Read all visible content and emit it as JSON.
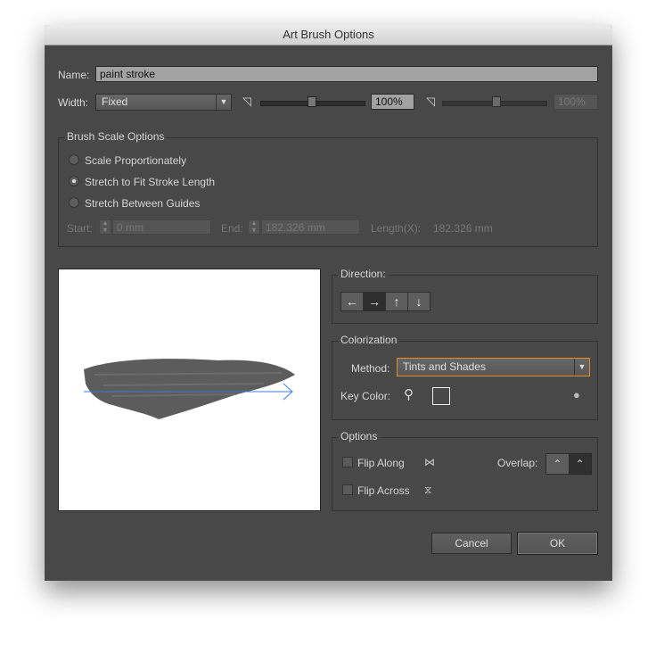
{
  "title": "Art Brush Options",
  "name": {
    "label": "Name:",
    "value": "paint stroke"
  },
  "width": {
    "label": "Width:",
    "selected": "Fixed",
    "value1": "100%",
    "value2": "100%",
    "slider1_percent": 100,
    "slider2_percent": 100
  },
  "brush_scale": {
    "title": "Brush Scale Options",
    "options": [
      "Scale Proportionately",
      "Stretch to Fit Stroke Length",
      "Stretch Between Guides"
    ],
    "selected_index": 1,
    "start_label": "Start:",
    "start_value": "0 mm",
    "end_label": "End:",
    "end_value": "182.326 mm",
    "length_label": "Length(X):",
    "length_value": "182.326 mm"
  },
  "direction": {
    "title": "Direction:",
    "buttons": [
      "←",
      "→",
      "↑",
      "↓"
    ],
    "selected_index": 1
  },
  "colorization": {
    "title": "Colorization",
    "method_label": "Method:",
    "method_value": "Tints and Shades",
    "key_color_label": "Key Color:",
    "accent": "#e8892b"
  },
  "options": {
    "title": "Options",
    "flip_along": "Flip Along",
    "flip_across": "Flip Across",
    "overlap_label": "Overlap:"
  },
  "buttons": {
    "cancel": "Cancel",
    "ok": "OK"
  }
}
